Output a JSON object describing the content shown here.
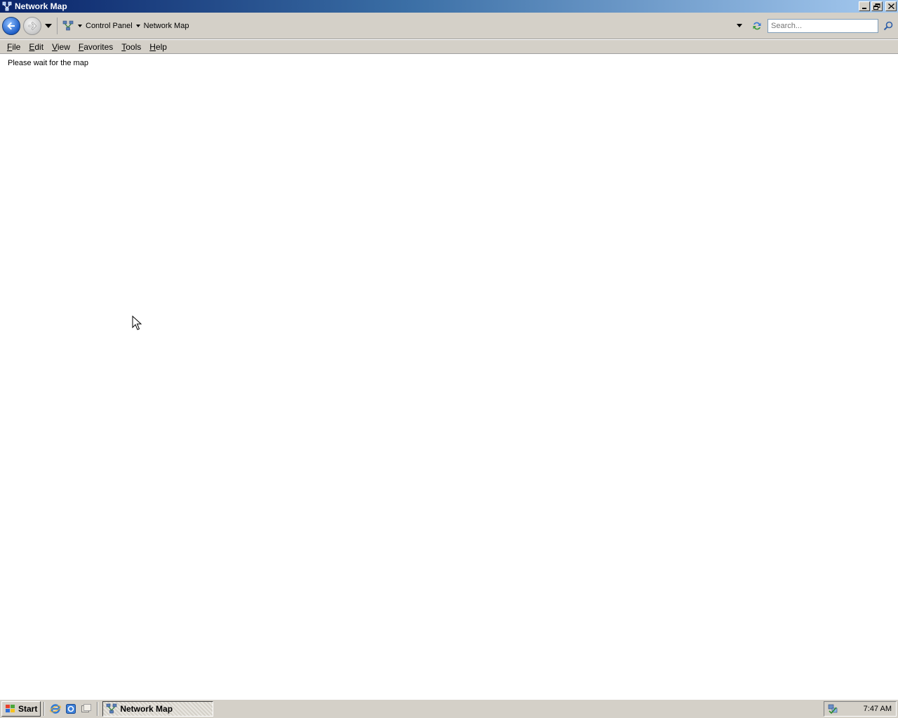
{
  "window": {
    "title": "Network Map"
  },
  "navigation": {
    "breadcrumbs": [
      "Control Panel",
      "Network Map"
    ],
    "search_placeholder": "Search..."
  },
  "menu": {
    "items": [
      {
        "label_u": "F",
        "label_rest": "ile"
      },
      {
        "label_u": "E",
        "label_rest": "dit"
      },
      {
        "label_u": "V",
        "label_rest": "iew"
      },
      {
        "label_u": "",
        "label_pre": "F",
        "label_rest": "avorites"
      },
      {
        "label_u": "T",
        "label_rest": "ools"
      },
      {
        "label_u": "H",
        "label_rest": "elp"
      }
    ]
  },
  "content": {
    "status_text": "Please wait for the map"
  },
  "taskbar": {
    "start_label": "Start",
    "task_label": "Network Map",
    "clock": "7:47 AM"
  },
  "colors": {
    "titlebar_start": "#0a246a",
    "titlebar_end": "#a6caf0",
    "chrome": "#d4d0c8"
  }
}
